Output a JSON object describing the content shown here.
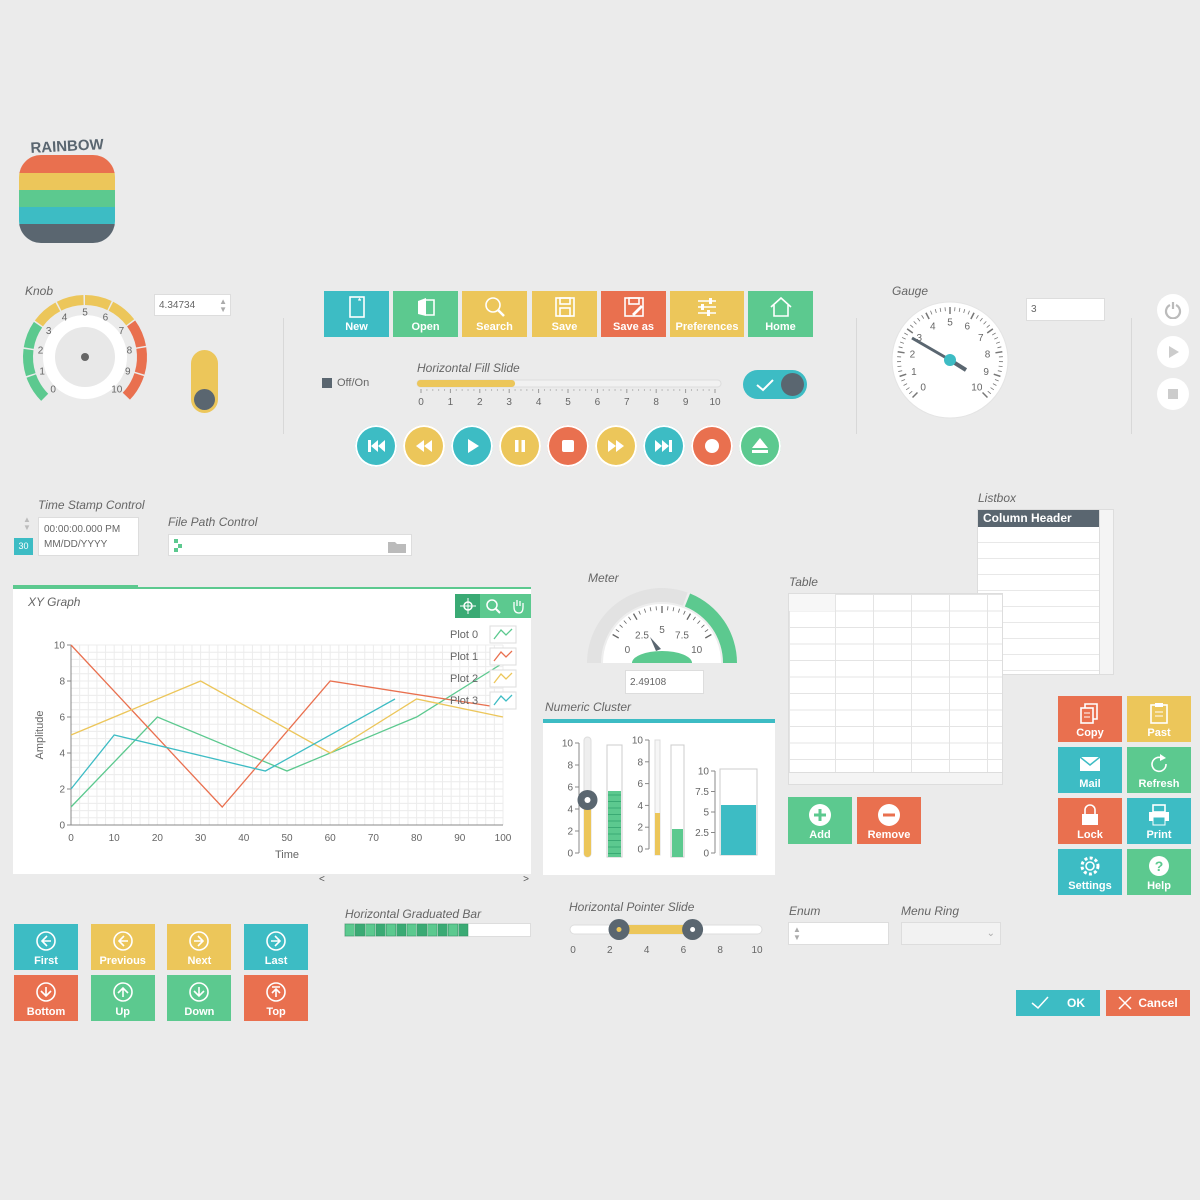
{
  "logo": {
    "text": "RAINBOW"
  },
  "knob": {
    "label": "Knob",
    "value": "4.34734",
    "ticks": [
      "0",
      "1",
      "2",
      "3",
      "4",
      "5",
      "6",
      "7",
      "8",
      "9",
      "10"
    ]
  },
  "toolbar": [
    {
      "label": "New",
      "color": "teal",
      "icon": "new-doc-icon"
    },
    {
      "label": "Open",
      "color": "green",
      "icon": "open-folder-icon"
    },
    {
      "label": "Search",
      "color": "yellow",
      "icon": "search-icon"
    },
    {
      "label": "Save",
      "color": "yellow",
      "icon": "save-icon"
    },
    {
      "label": "Save as",
      "color": "orange",
      "icon": "save-as-icon"
    },
    {
      "label": "Preferences",
      "color": "yellow",
      "icon": "sliders-icon"
    },
    {
      "label": "Home",
      "color": "green",
      "icon": "home-icon"
    }
  ],
  "offon": {
    "label": "Off/On"
  },
  "hfill": {
    "label": "Horizontal Fill Slide",
    "value": 3.2,
    "ticks": [
      "0",
      "1",
      "2",
      "3",
      "4",
      "5",
      "6",
      "7",
      "8",
      "9",
      "10"
    ]
  },
  "gauge": {
    "label": "Gauge",
    "value": "3",
    "ticks": [
      "0",
      "1",
      "2",
      "3",
      "4",
      "5",
      "6",
      "7",
      "8",
      "9",
      "10"
    ]
  },
  "timestamp": {
    "label": "Time Stamp Control",
    "time": "00:00:00.000 PM",
    "date": "MM/DD/YYYY",
    "badge": "30"
  },
  "filepath": {
    "label": "File Path Control"
  },
  "listbox": {
    "label": "Listbox",
    "header": "Column Header"
  },
  "xygraph": {
    "label": "XY Graph",
    "xlabel": "Time",
    "ylabel": "Amplitude",
    "xticks": [
      "0",
      "10",
      "20",
      "30",
      "40",
      "50",
      "60",
      "70",
      "80",
      "90",
      "100"
    ],
    "yticks": [
      "0",
      "2",
      "4",
      "6",
      "8",
      "10"
    ],
    "legend": [
      "Plot 0",
      "Plot 1",
      "Plot 2",
      "Plot 3"
    ]
  },
  "meter": {
    "label": "Meter",
    "value": "2.49108",
    "ticks": [
      "0",
      "2.5",
      "5",
      "7.5",
      "10"
    ]
  },
  "table": {
    "label": "Table"
  },
  "numeric_cluster": {
    "label": "Numeric Cluster",
    "ticks1": [
      "0",
      "2",
      "4",
      "6",
      "8",
      "10"
    ],
    "ticks2": [
      "0",
      "2",
      "4",
      "6",
      "8",
      "10"
    ],
    "ticks3": [
      "0",
      "2.5",
      "5",
      "7.5",
      "10"
    ]
  },
  "add_remove": [
    {
      "label": "Add"
    },
    {
      "label": "Remove"
    }
  ],
  "side_buttons": [
    {
      "label": "Copy",
      "color": "orange",
      "icon": "copy-icon"
    },
    {
      "label": "Past",
      "color": "yellow",
      "icon": "paste-icon"
    },
    {
      "label": "Mail",
      "color": "teal",
      "icon": "mail-icon"
    },
    {
      "label": "Refresh",
      "color": "green",
      "icon": "refresh-icon"
    },
    {
      "label": "Lock",
      "color": "orange",
      "icon": "lock-icon"
    },
    {
      "label": "Print",
      "color": "teal",
      "icon": "print-icon"
    },
    {
      "label": "Settings",
      "color": "teal",
      "icon": "gear-icon"
    },
    {
      "label": "Help",
      "color": "green",
      "icon": "help-icon"
    }
  ],
  "nav_buttons": [
    {
      "label": "First",
      "color": "teal",
      "icon": "arrow-left-icon"
    },
    {
      "label": "Previous",
      "color": "yellow",
      "icon": "arrow-left-icon"
    },
    {
      "label": "Next",
      "color": "yellow",
      "icon": "arrow-right-icon"
    },
    {
      "label": "Last",
      "color": "teal",
      "icon": "arrow-right-icon"
    },
    {
      "label": "Bottom",
      "color": "orange",
      "icon": "arrow-down-icon"
    },
    {
      "label": "Up",
      "color": "green",
      "icon": "arrow-up-icon"
    },
    {
      "label": "Down",
      "color": "green",
      "icon": "arrow-down-icon"
    },
    {
      "label": "Top",
      "color": "orange",
      "icon": "arrow-top-icon"
    }
  ],
  "hgraduated": {
    "label": "Horizontal Graduated Bar",
    "segments_filled": 12,
    "segments_total": 18
  },
  "hpointer": {
    "label": "Horizontal Pointer Slide",
    "low": 2.5,
    "high": 6.5,
    "ticks": [
      "0",
      "2",
      "4",
      "6",
      "8",
      "10"
    ]
  },
  "enum": {
    "label": "Enum"
  },
  "menuring": {
    "label": "Menu Ring"
  },
  "dialog": {
    "ok": "OK",
    "cancel": "Cancel"
  },
  "colors": {
    "teal": "#3dbcc4",
    "green": "#5cc98f",
    "yellow": "#ecc65a",
    "orange": "#e9704f",
    "gray": "#5a6670"
  }
}
